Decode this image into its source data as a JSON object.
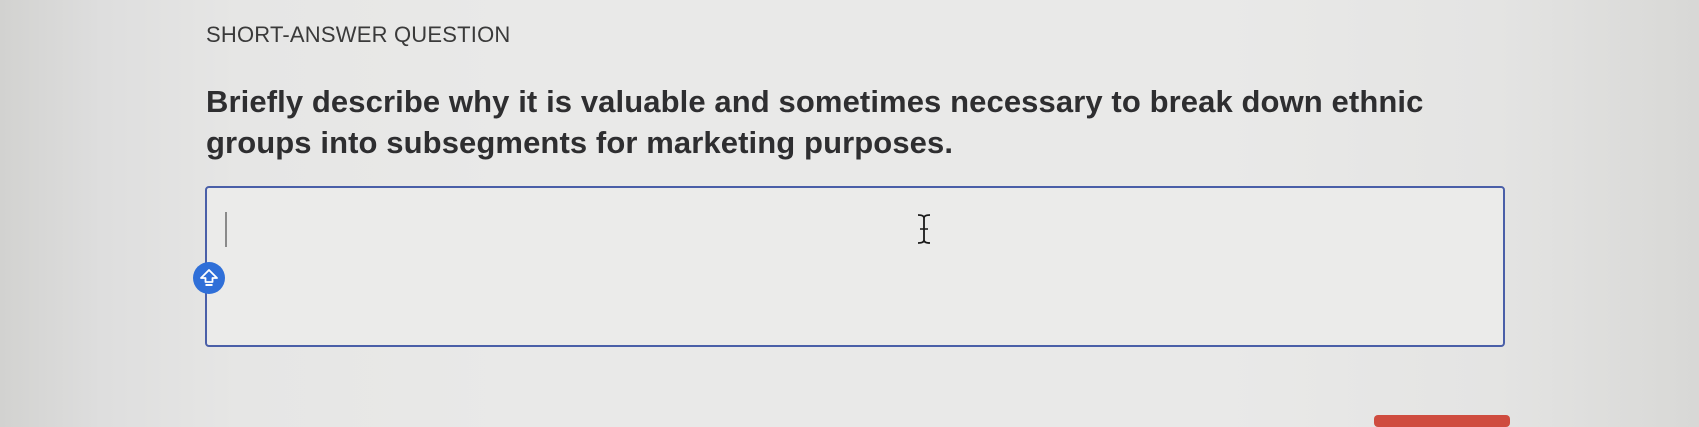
{
  "question": {
    "type_label": "SHORT-ANSWER QUESTION",
    "prompt": "Briefly describe why it is valuable and sometimes necessary to break down ethnic groups into subsegments for marketing purposes."
  },
  "answer": {
    "value": "",
    "focused": true
  },
  "icons": {
    "caps_badge": "shift-arrow-icon",
    "pointer": "text-cursor-icon"
  },
  "colors": {
    "box_border": "#4a5fa8",
    "badge": "#2f6fd8",
    "corner_button": "#cf4c3f"
  }
}
